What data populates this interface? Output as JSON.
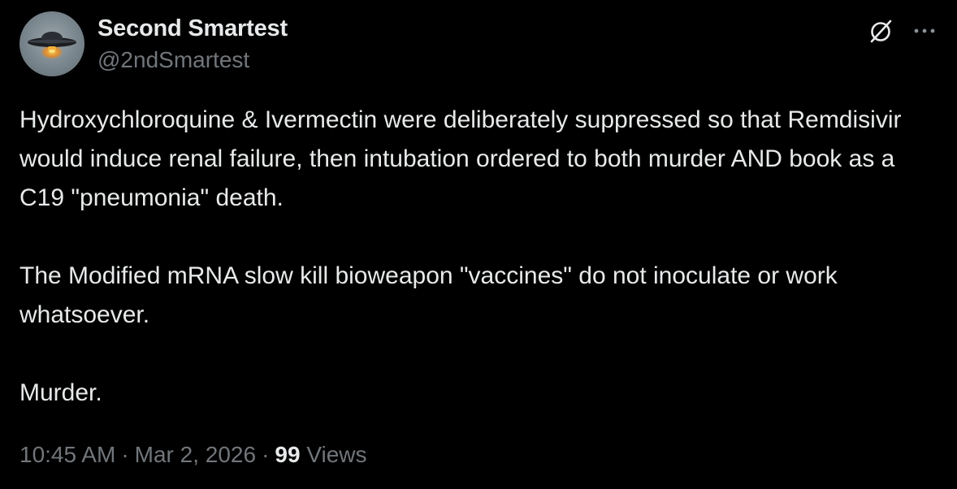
{
  "author": {
    "display_name": "Second Smartest",
    "handle": "@2ndSmartest"
  },
  "post": {
    "paragraphs": [
      "Hydroxychloroquine & Ivermectin were deliberately suppressed so that Remdisivir would induce renal failure, then intubation ordered to both murder AND book as a C19 \"pneumonia\" death.",
      "The Modified mRNA slow kill bioweapon \"vaccines\" do not inoculate or work whatsoever.",
      "Murder."
    ]
  },
  "meta": {
    "time": "10:45 AM",
    "separator": "·",
    "date": "Mar 2, 2026",
    "views_count": "99",
    "views_label": "Views"
  },
  "icons": {
    "avatar": "ufo-avatar-icon",
    "grok": "grok-icon",
    "more": "more-icon"
  },
  "colors": {
    "background": "#000000",
    "primary_text": "#e7e9ea",
    "secondary_text": "#71767b"
  }
}
